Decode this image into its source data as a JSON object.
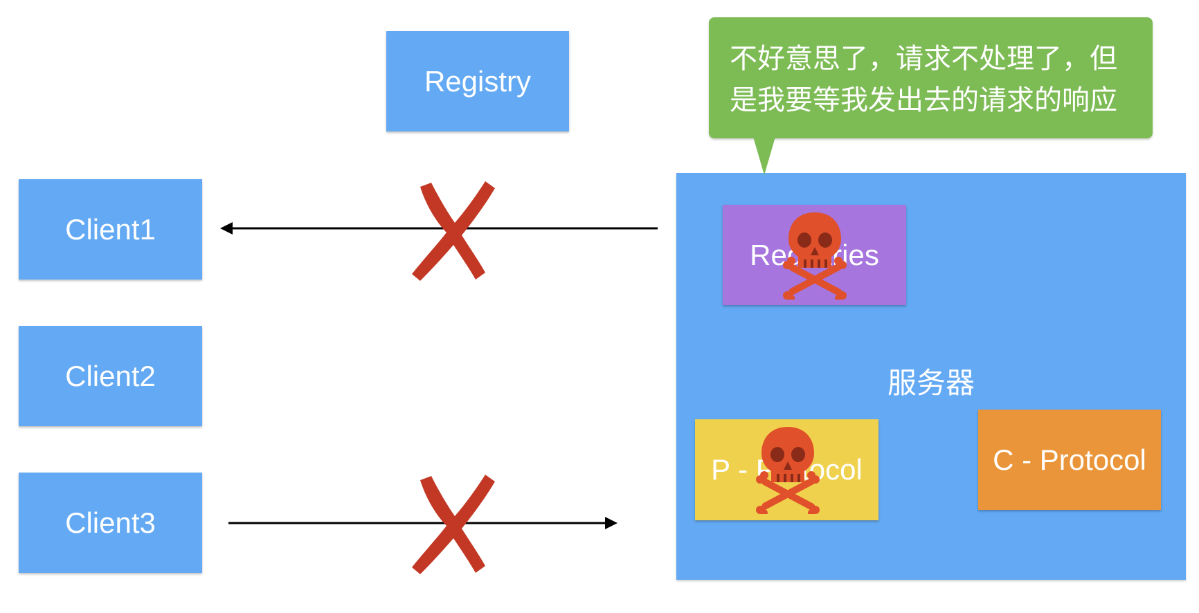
{
  "registry": {
    "label": "Registry"
  },
  "clients": [
    {
      "label": "Client1"
    },
    {
      "label": "Client2"
    },
    {
      "label": "Client3"
    }
  ],
  "server": {
    "label": "服务器",
    "registries_label": "Registries",
    "p_protocol_label": "P - Protocol",
    "c_protocol_label": "C - Protocol"
  },
  "callout": {
    "text": "不好意思了，请求不处理了，但是我要等我发出去的请求的响应"
  },
  "colors": {
    "box_blue": "#63a9f3",
    "callout_green": "#7dbb55",
    "registries_purple": "#a675de",
    "p_protocol_yellow": "#f0d14e",
    "c_protocol_orange": "#ea953a",
    "cross_red": "#c23824",
    "skull_red": "#e0502a"
  },
  "icons": [
    "cross-icon",
    "skull-crossbones-icon",
    "arrow-left-icon",
    "arrow-right-icon"
  ]
}
